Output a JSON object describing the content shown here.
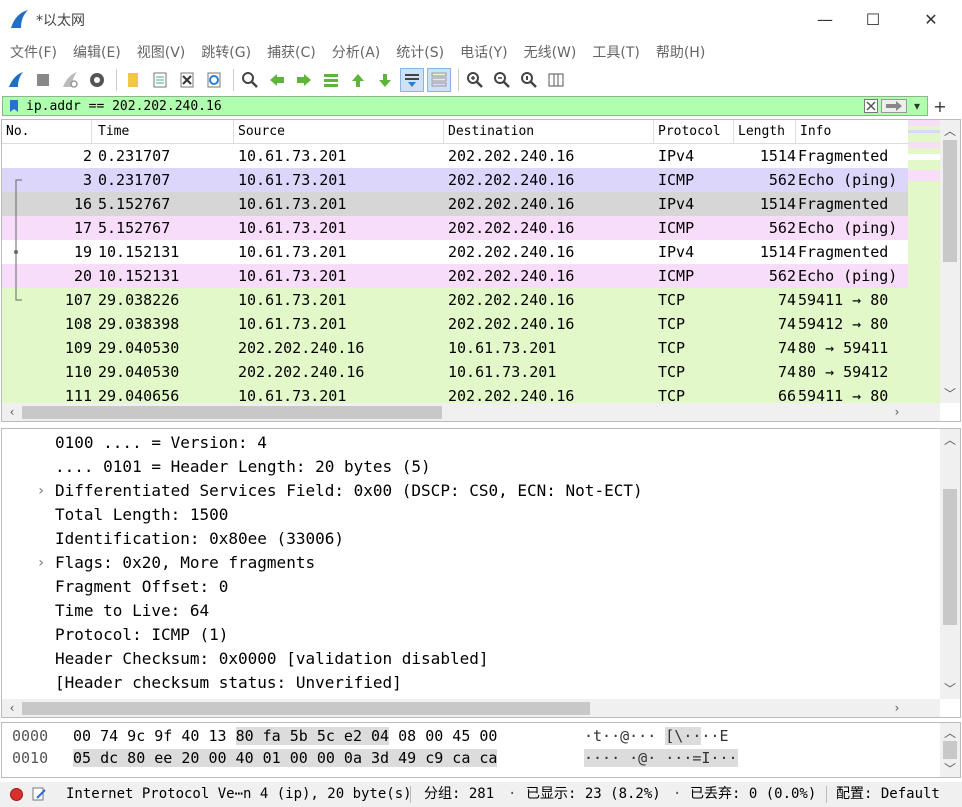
{
  "window": {
    "title": "*以太网",
    "minimize_glyph": "—",
    "maximize_glyph": "☐",
    "close_glyph": "✕"
  },
  "menu": [
    "文件(F)",
    "编辑(E)",
    "视图(V)",
    "跳转(G)",
    "捕获(C)",
    "分析(A)",
    "统计(S)",
    "电话(Y)",
    "无线(W)",
    "工具(T)",
    "帮助(H)"
  ],
  "toolbar": {
    "icons": [
      "shark-fin-start-icon",
      "stop-square-icon",
      "restart-fin-icon",
      "gear-options-icon",
      "open-folder-icon",
      "save-file-icon",
      "close-file-icon",
      "reload-icon",
      "find-packet-icon",
      "go-back-icon",
      "go-forward-icon",
      "go-to-packet-icon",
      "go-first-icon",
      "go-last-icon",
      "autoscroll-icon",
      "colorize-icon",
      "zoom-in-icon",
      "zoom-out-icon",
      "zoom-normal-icon",
      "resize-columns-icon"
    ]
  },
  "filter": {
    "value": "ip.addr == 202.202.240.16",
    "clear_glyph": "✕",
    "apply_glyph": "➡",
    "dropdown_glyph": "▾",
    "add_glyph": "+"
  },
  "packet_list": {
    "columns": [
      "No.",
      "Time",
      "Source",
      "Destination",
      "Protocol",
      "Length",
      "Info"
    ],
    "rows": [
      {
        "no": "2",
        "time": "0.231707",
        "src": "10.61.73.201",
        "dst": "202.202.240.16",
        "proto": "IPv4",
        "len": "1514",
        "info": "Fragmented",
        "bg": "#ffffff"
      },
      {
        "no": "3",
        "time": "0.231707",
        "src": "10.61.73.201",
        "dst": "202.202.240.16",
        "proto": "ICMP",
        "len": "562",
        "info": "Echo (ping)",
        "bg": "#ddd6fb"
      },
      {
        "no": "16",
        "time": "5.152767",
        "src": "10.61.73.201",
        "dst": "202.202.240.16",
        "proto": "IPv4",
        "len": "1514",
        "info": "Fragmented",
        "bg": "#d6d6d6"
      },
      {
        "no": "17",
        "time": "5.152767",
        "src": "10.61.73.201",
        "dst": "202.202.240.16",
        "proto": "ICMP",
        "len": "562",
        "info": "Echo (ping)",
        "bg": "#f8ddfa"
      },
      {
        "no": "19",
        "time": "10.152131",
        "src": "10.61.73.201",
        "dst": "202.202.240.16",
        "proto": "IPv4",
        "len": "1514",
        "info": "Fragmented",
        "bg": "#ffffff"
      },
      {
        "no": "20",
        "time": "10.152131",
        "src": "10.61.73.201",
        "dst": "202.202.240.16",
        "proto": "ICMP",
        "len": "562",
        "info": "Echo (ping)",
        "bg": "#f8ddfa"
      },
      {
        "no": "107",
        "time": "29.038226",
        "src": "10.61.73.201",
        "dst": "202.202.240.16",
        "proto": "TCP",
        "len": "74",
        "info": "59411 → 80",
        "bg": "#e2f8c8"
      },
      {
        "no": "108",
        "time": "29.038398",
        "src": "10.61.73.201",
        "dst": "202.202.240.16",
        "proto": "TCP",
        "len": "74",
        "info": "59412 → 80",
        "bg": "#e2f8c8"
      },
      {
        "no": "109",
        "time": "29.040530",
        "src": "202.202.240.16",
        "dst": "10.61.73.201",
        "proto": "TCP",
        "len": "74",
        "info": "80 → 59411",
        "bg": "#e2f8c8"
      },
      {
        "no": "110",
        "time": "29.040530",
        "src": "202.202.240.16",
        "dst": "10.61.73.201",
        "proto": "TCP",
        "len": "74",
        "info": "80 → 59412",
        "bg": "#e2f8c8"
      },
      {
        "no": "111",
        "time": "29.040656",
        "src": "10.61.73.201",
        "dst": "202.202.240.16",
        "proto": "TCP",
        "len": "66",
        "info": "59411 → 80",
        "bg": "#e2f8c8"
      }
    ]
  },
  "packet_details": [
    {
      "text": "0100 .... = Version: 4",
      "expander": ""
    },
    {
      "text": ".... 0101 = Header Length: 20 bytes (5)",
      "expander": ""
    },
    {
      "text": "Differentiated Services Field: 0x00 (DSCP: CS0, ECN: Not-ECT)",
      "expander": "›"
    },
    {
      "text": "Total Length: 1500",
      "expander": ""
    },
    {
      "text": "Identification: 0x80ee (33006)",
      "expander": ""
    },
    {
      "text": "Flags: 0x20, More fragments",
      "expander": "›"
    },
    {
      "text": "Fragment Offset: 0",
      "expander": ""
    },
    {
      "text": "Time to Live: 64",
      "expander": ""
    },
    {
      "text": "Protocol: ICMP (1)",
      "expander": ""
    },
    {
      "text": "Header Checksum: 0x0000 [validation disabled]",
      "expander": ""
    },
    {
      "text": "[Header checksum status: Unverified]",
      "expander": ""
    }
  ],
  "packet_bytes": [
    {
      "offset": "0000",
      "hex_plain": "00 74 9c 9f 40 13 ",
      "hex_hl": "80 fa  5b 5c e2 04",
      "hex_tail": " 08 00 45 00",
      "ascii_plain": "·t··@··· ",
      "ascii_hl": "[\\··",
      "ascii_tail": "··E"
    },
    {
      "offset": "0010",
      "hex_plain": "",
      "hex_hl": "05 dc 80 ee 20 00 40 01  00 00 0a 3d 49 c9 ca ca",
      "hex_tail": "",
      "ascii_plain": "",
      "ascii_hl": "···· ·@· ···=I···",
      "ascii_tail": ""
    }
  ],
  "status": {
    "field_text": "Internet Protocol Ve⋯n 4 (ip), 20 byte(s)",
    "packets": "分组: 281",
    "displayed": "已显示: 23 (8.2%)",
    "dropped": "已丢弃: 0 (0.0%)",
    "profile": "配置: Default"
  },
  "colors": {
    "filter_valid": "#afffaf",
    "icmp_row": "#f8ddfa",
    "tcp_row": "#e2f8c8",
    "selected_row": "#d6d6d6",
    "capture_red": "#d8312c"
  }
}
